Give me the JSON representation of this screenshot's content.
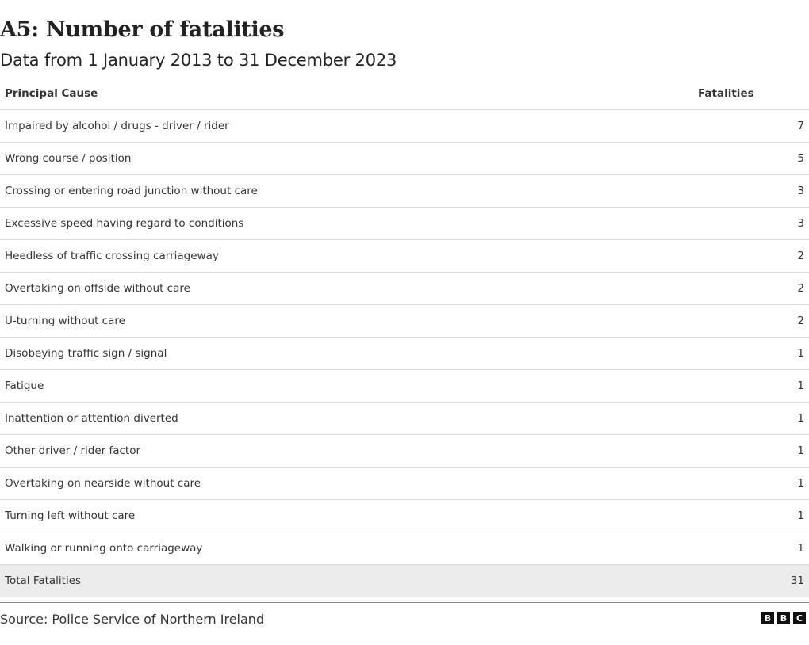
{
  "header": {
    "title": "A5: Number of fatalities",
    "subtitle": "Data from 1 January 2013 to 31 December 2023"
  },
  "chart_data": {
    "type": "table",
    "title": "A5: Number of fatalities",
    "subtitle": "Data from 1 January 2013 to 31 December 2023",
    "columns": [
      "Principal Cause",
      "Fatalities"
    ],
    "rows": [
      {
        "cause": "Impaired by alcohol / drugs - driver / rider",
        "fatalities": "7"
      },
      {
        "cause": "Wrong course / position",
        "fatalities": "5"
      },
      {
        "cause": "Crossing or entering road junction without care",
        "fatalities": "3"
      },
      {
        "cause": "Excessive speed having regard to conditions",
        "fatalities": "3"
      },
      {
        "cause": "Heedless of traffic crossing carriageway",
        "fatalities": "2"
      },
      {
        "cause": "Overtaking on offside without care",
        "fatalities": "2"
      },
      {
        "cause": "U-turning without care",
        "fatalities": "2"
      },
      {
        "cause": "Disobeying traffic sign / signal",
        "fatalities": "1"
      },
      {
        "cause": "Fatigue",
        "fatalities": "1"
      },
      {
        "cause": "Inattention or attention diverted",
        "fatalities": "1"
      },
      {
        "cause": "Other driver / rider factor",
        "fatalities": "1"
      },
      {
        "cause": "Overtaking on nearside without care",
        "fatalities": "1"
      },
      {
        "cause": "Turning left without care",
        "fatalities": "1"
      },
      {
        "cause": "Walking or running onto carriageway",
        "fatalities": "1"
      }
    ],
    "total": {
      "label": "Total Fatalities",
      "fatalities": "31"
    }
  },
  "footer": {
    "source": "Source: Police Service of Northern Ireland",
    "logo_letters": [
      "B",
      "B",
      "C"
    ]
  }
}
